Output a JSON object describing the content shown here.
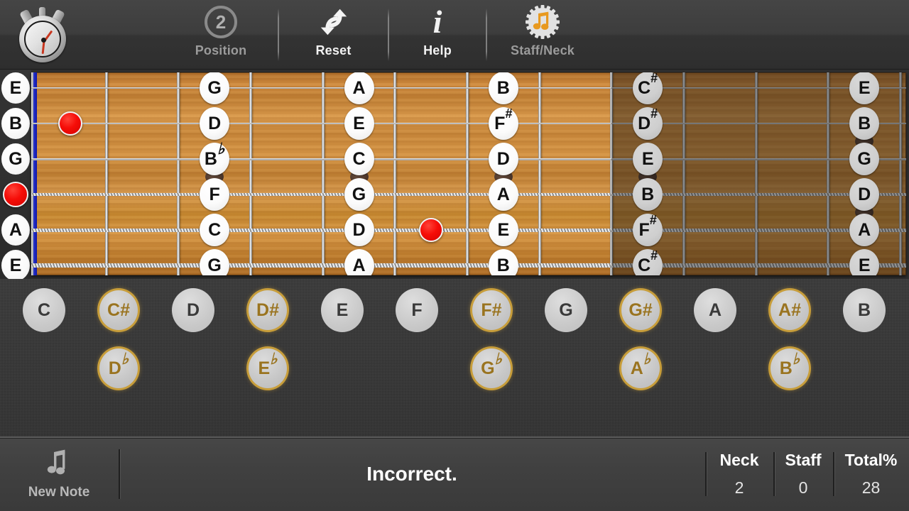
{
  "toolbar": {
    "timer_icon": "stopwatch-icon",
    "position": {
      "label": "Position",
      "value": "2",
      "icon": "circled-number-icon"
    },
    "reset": {
      "label": "Reset",
      "icon": "reset-arrows-icon"
    },
    "help": {
      "label": "Help",
      "icon": "info-i-icon"
    },
    "staffneck": {
      "label": "Staff/Neck",
      "icon": "music-note-gear-icon"
    }
  },
  "neck": {
    "open_strings": [
      "E",
      "B",
      "G",
      "",
      "A",
      "E"
    ],
    "open_marker_string_index": 3,
    "frets": 12,
    "dimmed_from_fret": 9,
    "notes": [
      {
        "string": 0,
        "fret": 3,
        "label": "G",
        "accidental": "",
        "dim": false
      },
      {
        "string": 1,
        "fret": 3,
        "label": "D",
        "accidental": "",
        "dim": false
      },
      {
        "string": 2,
        "fret": 3,
        "label": "B",
        "accidental": "b",
        "dim": false
      },
      {
        "string": 3,
        "fret": 3,
        "label": "F",
        "accidental": "",
        "dim": false
      },
      {
        "string": 4,
        "fret": 3,
        "label": "C",
        "accidental": "",
        "dim": false
      },
      {
        "string": 5,
        "fret": 3,
        "label": "G",
        "accidental": "",
        "dim": false
      },
      {
        "string": 0,
        "fret": 5,
        "label": "A",
        "accidental": "",
        "dim": false
      },
      {
        "string": 1,
        "fret": 5,
        "label": "E",
        "accidental": "",
        "dim": false
      },
      {
        "string": 2,
        "fret": 5,
        "label": "C",
        "accidental": "",
        "dim": false
      },
      {
        "string": 3,
        "fret": 5,
        "label": "G",
        "accidental": "",
        "dim": false
      },
      {
        "string": 4,
        "fret": 5,
        "label": "D",
        "accidental": "",
        "dim": false
      },
      {
        "string": 5,
        "fret": 5,
        "label": "A",
        "accidental": "",
        "dim": false
      },
      {
        "string": 0,
        "fret": 7,
        "label": "B",
        "accidental": "",
        "dim": false
      },
      {
        "string": 1,
        "fret": 7,
        "label": "F",
        "accidental": "#",
        "dim": false
      },
      {
        "string": 2,
        "fret": 7,
        "label": "D",
        "accidental": "",
        "dim": false
      },
      {
        "string": 3,
        "fret": 7,
        "label": "A",
        "accidental": "",
        "dim": false
      },
      {
        "string": 4,
        "fret": 7,
        "label": "E",
        "accidental": "",
        "dim": false
      },
      {
        "string": 5,
        "fret": 7,
        "label": "B",
        "accidental": "",
        "dim": false
      },
      {
        "string": 0,
        "fret": 9,
        "label": "C",
        "accidental": "#",
        "dim": true
      },
      {
        "string": 1,
        "fret": 9,
        "label": "D",
        "accidental": "#",
        "dim": true
      },
      {
        "string": 2,
        "fret": 9,
        "label": "E",
        "accidental": "",
        "dim": true
      },
      {
        "string": 3,
        "fret": 9,
        "label": "B",
        "accidental": "",
        "dim": true
      },
      {
        "string": 4,
        "fret": 9,
        "label": "F",
        "accidental": "#",
        "dim": true
      },
      {
        "string": 5,
        "fret": 9,
        "label": "C",
        "accidental": "#",
        "dim": true
      },
      {
        "string": 0,
        "fret": 12,
        "label": "E",
        "accidental": "",
        "dim": true
      },
      {
        "string": 1,
        "fret": 12,
        "label": "B",
        "accidental": "",
        "dim": true
      },
      {
        "string": 2,
        "fret": 12,
        "label": "G",
        "accidental": "",
        "dim": true
      },
      {
        "string": 3,
        "fret": 12,
        "label": "D",
        "accidental": "",
        "dim": true
      },
      {
        "string": 4,
        "fret": 12,
        "label": "A",
        "accidental": "",
        "dim": true
      },
      {
        "string": 5,
        "fret": 12,
        "label": "E",
        "accidental": "",
        "dim": true
      }
    ],
    "red_markers": [
      {
        "string": 1,
        "fret": 1
      },
      {
        "string": 4,
        "fret": 6
      }
    ],
    "inlays": [
      {
        "fret": 3,
        "between_strings": [
          2,
          3
        ]
      },
      {
        "fret": 5,
        "between_strings": [
          2,
          3
        ]
      },
      {
        "fret": 7,
        "between_strings": [
          2,
          3
        ]
      },
      {
        "fret": 9,
        "between_strings": [
          2,
          3
        ]
      },
      {
        "fret": 12,
        "between_strings": [
          1,
          2
        ]
      },
      {
        "fret": 12,
        "between_strings": [
          3,
          4
        ]
      }
    ]
  },
  "pads": {
    "naturals": [
      {
        "label": "C",
        "accidental": "",
        "type": "natural"
      },
      {
        "label": "C",
        "accidental": "#",
        "type": "sharp"
      },
      {
        "label": "D",
        "accidental": "",
        "type": "natural"
      },
      {
        "label": "D",
        "accidental": "#",
        "type": "sharp"
      },
      {
        "label": "E",
        "accidental": "",
        "type": "natural"
      },
      {
        "label": "F",
        "accidental": "",
        "type": "natural"
      },
      {
        "label": "F",
        "accidental": "#",
        "type": "sharp"
      },
      {
        "label": "G",
        "accidental": "",
        "type": "natural"
      },
      {
        "label": "G",
        "accidental": "#",
        "type": "sharp"
      },
      {
        "label": "A",
        "accidental": "",
        "type": "natural"
      },
      {
        "label": "A",
        "accidental": "#",
        "type": "sharp"
      },
      {
        "label": "B",
        "accidental": "",
        "type": "natural"
      }
    ],
    "flats": [
      {
        "label": "D",
        "accidental": "b",
        "col": 1
      },
      {
        "label": "E",
        "accidental": "b",
        "col": 3
      },
      {
        "label": "G",
        "accidental": "b",
        "col": 6
      },
      {
        "label": "A",
        "accidental": "b",
        "col": 8
      },
      {
        "label": "B",
        "accidental": "b",
        "col": 10
      }
    ]
  },
  "status": {
    "new_note_label": "New Note",
    "new_note_icon": "music-note-icon",
    "message": "Incorrect.",
    "scores": [
      {
        "header": "Neck",
        "value": "2"
      },
      {
        "header": "Staff",
        "value": "0"
      },
      {
        "header": "Total%",
        "value": "28"
      }
    ]
  },
  "colors": {
    "accent_gold": "#c79d3a",
    "marker_red": "#f60d08",
    "nut_blue": "#1016a6",
    "fretboard_wood": "#c8873a",
    "panel_dark": "#3a3a3a"
  }
}
